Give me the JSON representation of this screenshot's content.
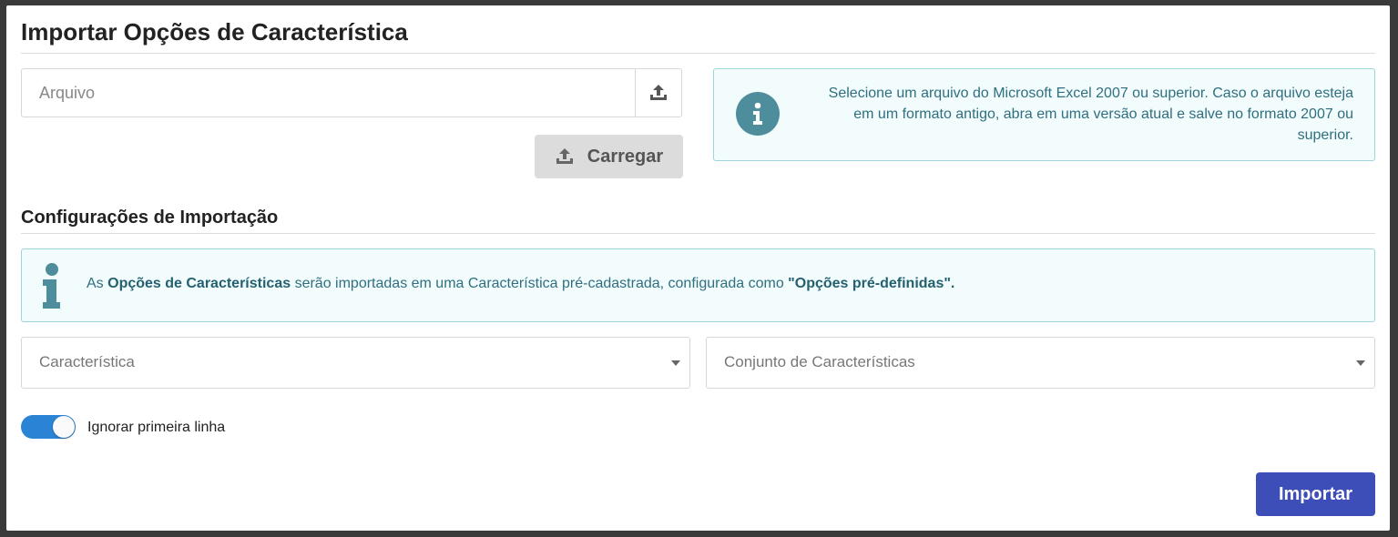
{
  "page": {
    "title": "Importar Opções de Característica"
  },
  "file": {
    "placeholder": "Arquivo",
    "browse_icon": "upload-icon",
    "upload_label": "Carregar"
  },
  "info_right": {
    "icon": "info-circle-icon",
    "text": "Selecione um arquivo do Microsoft Excel 2007 ou superior. Caso o arquivo esteja em um formato antigo, abra em uma versão atual e salve no formato 2007 ou superior."
  },
  "settings": {
    "title": "Configurações de Importação",
    "info": {
      "icon": "info-icon",
      "prefix": "As ",
      "highlight1": "Opções de Características",
      "middle": " serão importadas em uma Característica pré-cadastrada, configurada como ",
      "highlight2": "\"Opções pré-definidas\".",
      "suffix": ""
    },
    "select_caracteristica": "Característica",
    "select_conjunto": "Conjunto de Características",
    "toggle_label": "Ignorar primeira linha",
    "toggle_on": true
  },
  "actions": {
    "import_label": "Importar"
  },
  "colors": {
    "primary": "#3d4eb8",
    "toggle": "#2b83d6",
    "info_bg": "#f2fcfd",
    "info_border": "#9ed5dc",
    "info_text": "#2f6f80"
  }
}
